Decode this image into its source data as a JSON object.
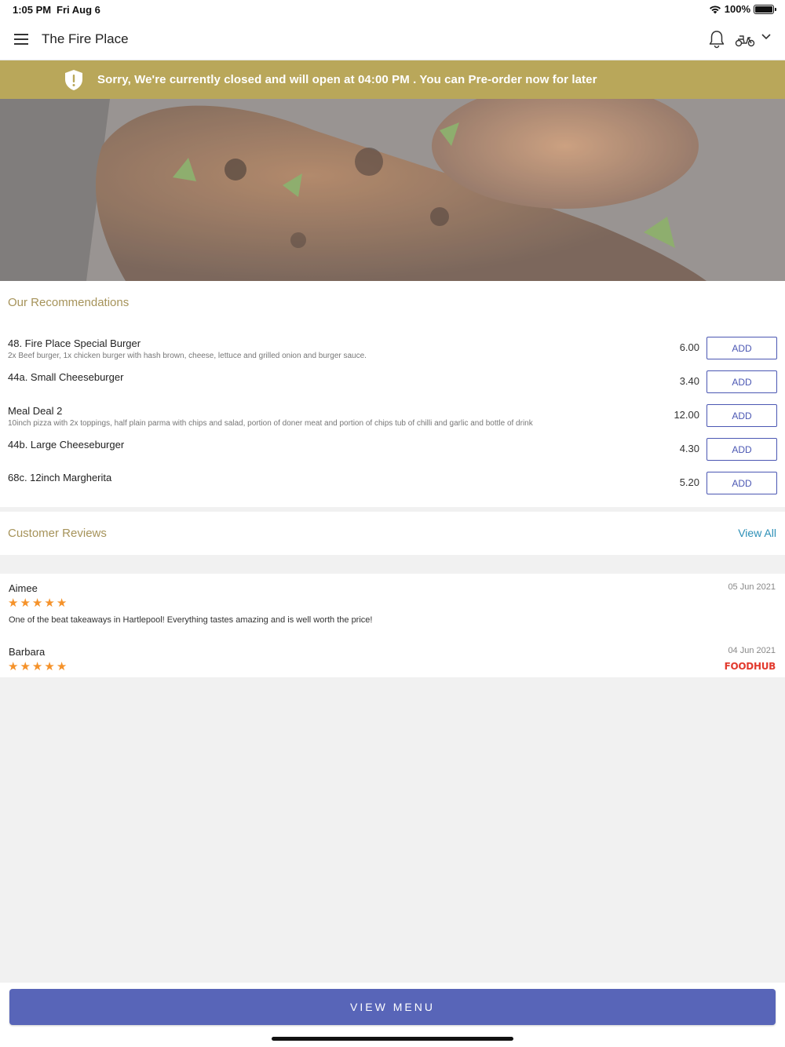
{
  "status_bar": {
    "time": "1:05 PM",
    "date": "Fri Aug 6",
    "battery": "100%"
  },
  "header": {
    "title": "The Fire Place",
    "icons": [
      "menu-icon",
      "bell-icon",
      "scooter-icon",
      "chevron-down-icon"
    ]
  },
  "banner": {
    "message": "Sorry, We're currently closed and will open at 04:00 PM . You can Pre-order now for later",
    "icon": "shield-alert-icon",
    "color": "#b9a75a"
  },
  "recommendations": {
    "title": "Our Recommendations",
    "add_label": "ADD",
    "items": [
      {
        "name": "48. Fire Place Special Burger",
        "description": "2x Beef burger, 1x chicken burger with hash brown, cheese, lettuce and grilled onion and burger sauce.",
        "price": "6.00"
      },
      {
        "name": "44a. Small Cheeseburger",
        "description": "",
        "price": "3.40"
      },
      {
        "name": "Meal Deal 2",
        "description": "10inch pizza with 2x toppings, half plain parma with chips and salad, portion of doner meat and portion of chips tub of chilli and garlic and bottle of drink",
        "price": "12.00"
      },
      {
        "name": "44b. Large Cheeseburger",
        "description": "",
        "price": "4.30"
      },
      {
        "name": "68c. 12inch Margherita",
        "description": "",
        "price": "5.20"
      }
    ]
  },
  "reviews": {
    "title": "Customer Reviews",
    "view_all": "View All",
    "items": [
      {
        "author": "Aimee",
        "date": "05 Jun 2021",
        "rating": 5,
        "text": "One of the beat takeaways in Hartlepool! Everything tastes amazing and is well worth the price!"
      },
      {
        "author": "Barbara",
        "date": "04 Jun 2021",
        "rating": 5,
        "text": "",
        "source": "FOODHUB"
      }
    ]
  },
  "footer": {
    "button_label": "VIEW MENU"
  },
  "colors": {
    "accent": "#5865b8",
    "section_title": "#a6935a",
    "star": "#f5922a",
    "link": "#2c8fb6"
  }
}
